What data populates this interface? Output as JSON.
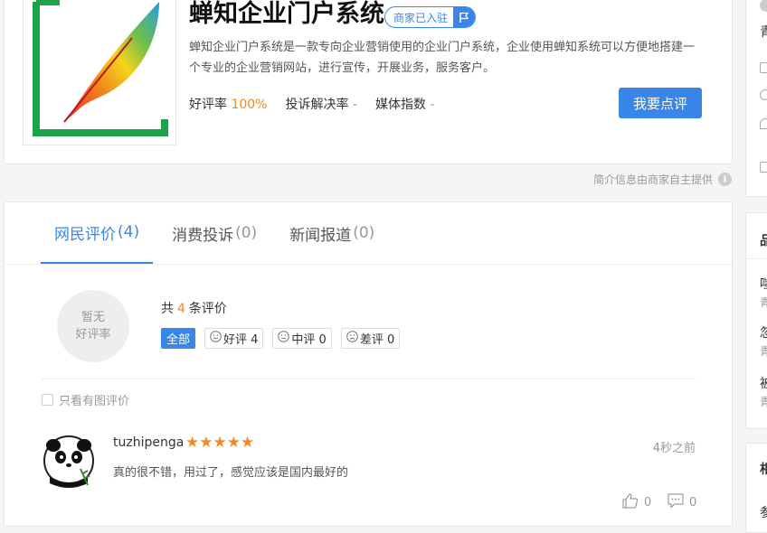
{
  "company": {
    "name": "蝉知企业门户系统",
    "badge_label": "商家已入驻",
    "description": "蝉知企业门户系统是一款专向企业营销使用的企业门户系统，企业使用蝉知系统可以方便地搭建一个专业的企业营销网站，进行宣传，开展业务，服务客户。",
    "stats": {
      "good_rate_label": "好评率",
      "good_rate_value": "100%",
      "complaint_label": "投诉解决率",
      "complaint_value": "-",
      "media_label": "媒体指数",
      "media_value": "-"
    },
    "review_button": "我要点评",
    "provided_note": "简介信息由商家自主提供"
  },
  "reviews": {
    "tabs": [
      {
        "label": "网民评价",
        "count": "(4)",
        "active": true
      },
      {
        "label": "消费投诉",
        "count": "(0)",
        "active": false
      },
      {
        "label": "新闻报道",
        "count": "(0)",
        "active": false
      }
    ],
    "rate_circle": {
      "line1": "暂无",
      "line2": "好评率"
    },
    "total": {
      "prefix": "共",
      "count": "4",
      "suffix": "条评价"
    },
    "filters": [
      {
        "label": "全部",
        "active": true
      },
      {
        "label": "好评 4",
        "active": false,
        "icon": "smile-face-icon"
      },
      {
        "label": "中评 0",
        "active": false,
        "icon": "neutral-face-icon"
      },
      {
        "label": "差评 0",
        "active": false,
        "icon": "sad-face-icon"
      }
    ],
    "image_only_label": "只看有图评价",
    "items": [
      {
        "username": "tuzhipenga",
        "stars": 5,
        "time": "4秒之前",
        "text": "真的很不错，用过了，感觉应该是国内最好的",
        "likes": "0",
        "comments": "0"
      }
    ]
  },
  "sidebar": {
    "card1": {
      "title": "青",
      "icons": [
        "briefcase-icon",
        "globe-icon",
        "location-icon",
        "edit-icon"
      ]
    },
    "card2": {
      "title": "品",
      "items": [
        {
          "name": "嗤",
          "sub": "青"
        },
        {
          "name": "忽",
          "sub": "青"
        },
        {
          "name": "被",
          "sub": "青"
        }
      ]
    },
    "card3": {
      "title": "相",
      "item": "参"
    }
  },
  "colors": {
    "accent": "#3a86e8",
    "orange": "#f08a24"
  }
}
